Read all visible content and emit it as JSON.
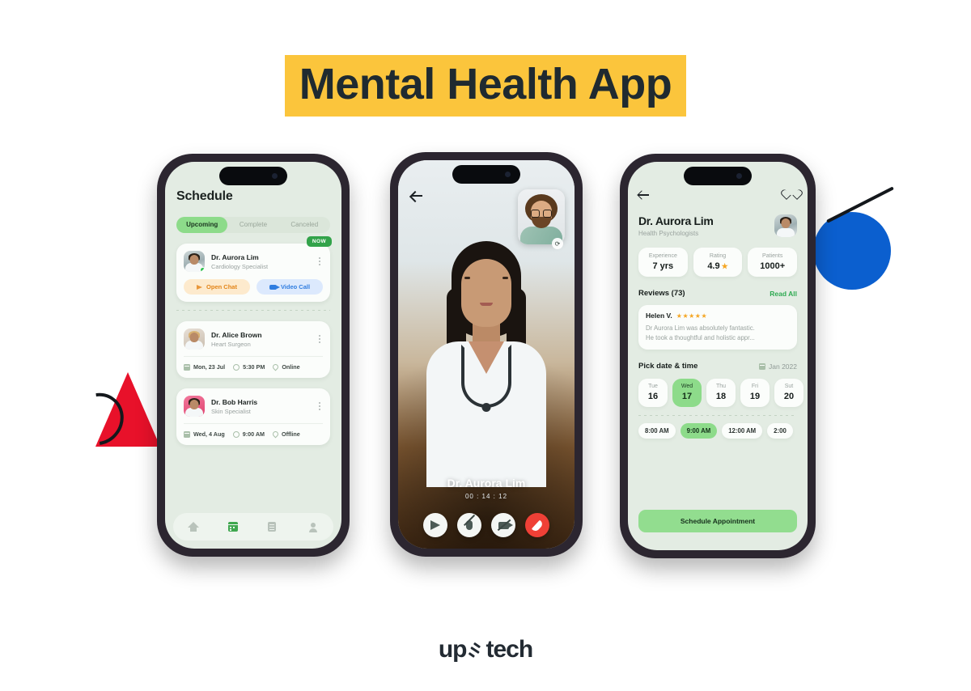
{
  "page": {
    "title": "Mental Health App",
    "title_highlight_color": "#fbc53c",
    "background_color": "#ffffff",
    "footer_logo": {
      "text_left": "up",
      "text_right": "tech",
      "mark": "arrow-mark"
    }
  },
  "decorations": {
    "circle_color": "#0b5fcf",
    "triangle_color": "#e8112a",
    "line_color": "#14181c"
  },
  "phone_schedule": {
    "screen_title": "Schedule",
    "tabs": [
      {
        "label": "Upcoming",
        "active": true
      },
      {
        "label": "Complete",
        "active": false
      },
      {
        "label": "Canceled",
        "active": false
      }
    ],
    "appointments": [
      {
        "badge": "NOW",
        "name": "Dr. Aurora Lim",
        "specialty": "Cardiology Specialist",
        "online": true,
        "actions": [
          {
            "label": "Open Chat",
            "icon": "send-icon",
            "style": "orange"
          },
          {
            "label": "Video Call",
            "icon": "video-camera-icon",
            "style": "blue"
          }
        ]
      },
      {
        "name": "Dr. Alice Brown",
        "specialty": "Heart Surgeon",
        "meta": [
          {
            "icon": "calendar-icon",
            "label": "Mon, 23 Jul"
          },
          {
            "icon": "clock-icon",
            "label": "5:30 PM"
          },
          {
            "icon": "location-pin-icon",
            "label": "Online"
          }
        ]
      },
      {
        "name": "Dr. Bob Harris",
        "specialty": "Skin Specialist",
        "meta": [
          {
            "icon": "calendar-icon",
            "label": "Wed, 4 Aug"
          },
          {
            "icon": "clock-icon",
            "label": "9:00 AM"
          },
          {
            "icon": "location-pin-icon",
            "label": "Offline"
          }
        ]
      }
    ],
    "tabbar": [
      {
        "icon": "home-icon",
        "active": false
      },
      {
        "icon": "calendar-icon",
        "active": true
      },
      {
        "icon": "document-icon",
        "active": false
      },
      {
        "icon": "person-icon",
        "active": false
      }
    ]
  },
  "phone_call": {
    "back_icon": "back-arrow-icon",
    "pip": {
      "flip_icon": "camera-flip-icon"
    },
    "caller_name": "Dr. Aurora Lim",
    "timer": "00 : 14 : 12",
    "controls": [
      {
        "icon": "send-icon",
        "label": "Send"
      },
      {
        "icon": "microphone-muted-icon",
        "label": "Mute"
      },
      {
        "icon": "video-off-icon",
        "label": "Stop video"
      },
      {
        "icon": "end-call-icon",
        "label": "End call",
        "style": "end"
      }
    ]
  },
  "phone_profile": {
    "back_icon": "back-arrow-icon",
    "favorite_icon": "heart-icon",
    "name": "Dr. Aurora Lim",
    "specialty": "Health Psychologists",
    "stats": [
      {
        "label": "Experience",
        "value": "7 yrs"
      },
      {
        "label": "Rating",
        "value": "4.9",
        "star": "★"
      },
      {
        "label": "Patients",
        "value": "1000+"
      }
    ],
    "reviews_title": "Reviews (73)",
    "reviews_link": "Read All",
    "review": {
      "author": "Helen V.",
      "stars": "★★★★★",
      "line1": "Dr Aurora Lim was absolutely fantastic.",
      "line2": "He took a thoughtful and holistic appr..."
    },
    "picker_title": "Pick date & time",
    "picker_month": "Jan 2022",
    "days": [
      {
        "name": "Tue",
        "num": "16",
        "active": false
      },
      {
        "name": "Wed",
        "num": "17",
        "active": true
      },
      {
        "name": "Thu",
        "num": "18",
        "active": false
      },
      {
        "name": "Fri",
        "num": "19",
        "active": false
      },
      {
        "name": "Sut",
        "num": "20",
        "active": false
      }
    ],
    "times": [
      {
        "label": "8:00 AM",
        "active": false
      },
      {
        "label": "9:00 AM",
        "active": true
      },
      {
        "label": "12:00 AM",
        "active": false
      },
      {
        "label": "2:00",
        "active": false
      }
    ],
    "cta_label": "Schedule Appointment"
  }
}
